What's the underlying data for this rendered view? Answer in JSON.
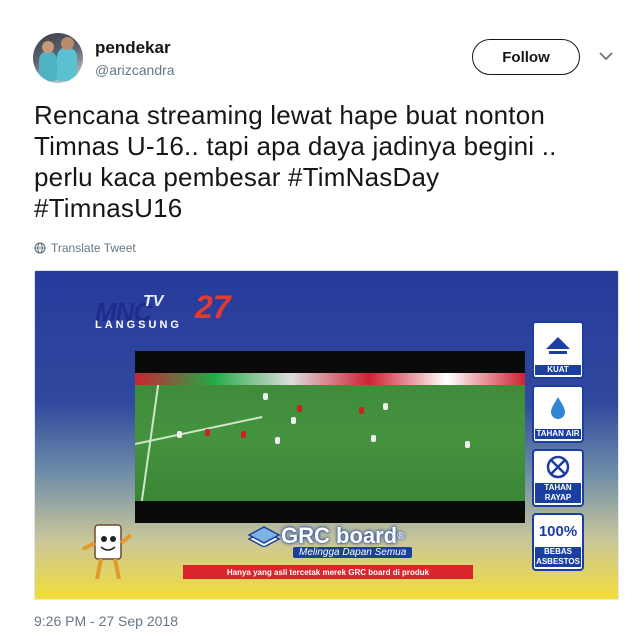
{
  "author": {
    "name": "pendekar",
    "handle": "@arizcandra"
  },
  "follow_label": "Follow",
  "tweet": {
    "lines": [
      "Rencana streaming lewat hape buat nonton",
      "Timnas U-16.. tapi apa daya jadinya begini ..",
      "perlu kaca pembesar #TimNasDay",
      "#TimnasU16"
    ]
  },
  "translate_label": "Translate Tweet",
  "media": {
    "channel_logo": "MNC",
    "channel_logo_tv": "TV",
    "channel_logo_number": "27",
    "live_label": "LANGSUNG",
    "badges": [
      {
        "caption": "KUAT",
        "icon": "hammer-icon"
      },
      {
        "caption": "TAHAN AIR",
        "icon": "water-drop-icon"
      },
      {
        "caption": "TAHAN RAYAP",
        "icon": "no-termite-icon"
      },
      {
        "caption": "BEBAS ASBESTOS",
        "value": "100%"
      }
    ],
    "brand": "GRC board",
    "brand_mark": "®",
    "slogan": "Melingga Dapan Semua",
    "banner_text": "Hanya yang asli tercetak merek GRC board di produk"
  },
  "timestamp": "9:26 PM - 27 Sep 2018",
  "colors": {
    "text": "#14171a",
    "secondary": "#657786",
    "ad_blue": "#1a3fa0",
    "ad_red": "#d8262c",
    "ad_yellow": "#f3dd3a"
  }
}
